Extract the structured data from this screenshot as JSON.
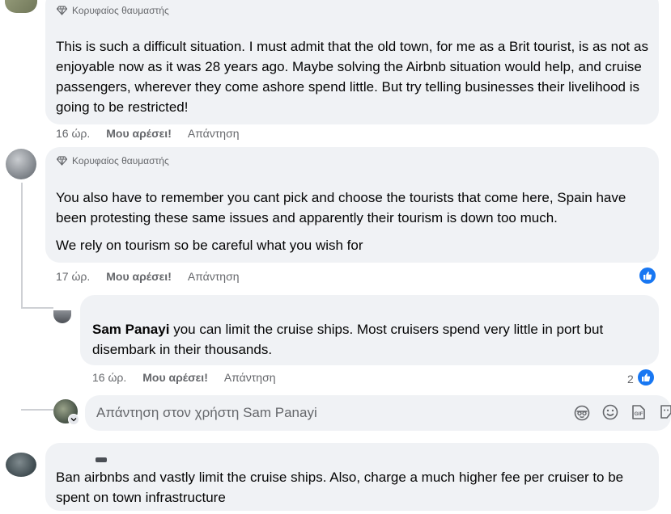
{
  "comments": [
    {
      "badge": "Κορυφαίος θαυμαστής",
      "text": "This is such a difficult situation. I must admit that the old town, for me as a Brit tourist, is as not as enjoyable now as it was 28 years ago. Maybe solving the Airbnb situation would help, and cruise passengers, wherever they come ashore spend little. But try telling businesses their livelihood is going to be restricted!",
      "time": "16 ώρ.",
      "like": "Μου αρέσει!",
      "reply": "Απάντηση"
    },
    {
      "badge": "Κορυφαίος θαυμαστής",
      "text1": "You also have to remember you cant pick and choose the tourists that come here, Spain have been protesting these same issues and apparently their tourism is down too much.",
      "text2": "We rely on tourism so be careful what you wish for",
      "time": "17 ώρ.",
      "like": "Μου αρέσει!",
      "reply": "Απάντηση"
    },
    {
      "author": "Sam Panayi",
      "text": "you can limit the cruise ships. Most cruisers spend very little in port but disembark in their thousands.",
      "time": "16 ώρ.",
      "like": "Μου αρέσει!",
      "reply": "Απάντηση",
      "reactions": "2"
    },
    {
      "text": "Ban airbnbs and vastly limit the cruise ships. Also, charge a much higher fee per cruiser to be spent on town infrastructure"
    }
  ],
  "reply_input": {
    "placeholder": "Απάντηση στον χρήστη Sam Panayi"
  },
  "icons": {
    "badge": "diamond-icon",
    "reaction": "thumbs-up-icon",
    "tools": [
      "avatar-sticker-icon",
      "emoji-icon",
      "gif-icon",
      "sticker-icon"
    ]
  },
  "colors": {
    "bubble": "#f0f2f5",
    "meta": "#65676b",
    "like_blue": "#1877f2"
  }
}
